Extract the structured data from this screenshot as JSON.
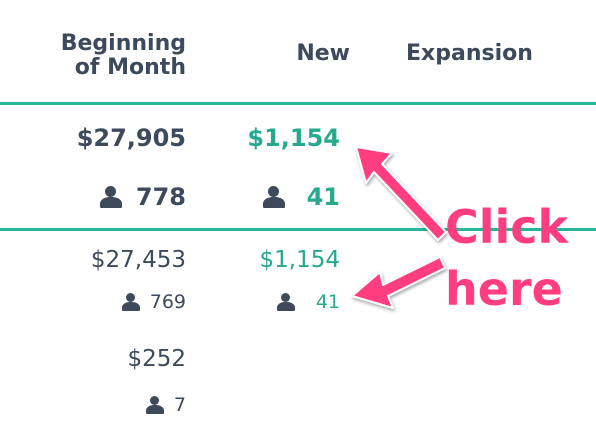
{
  "columns": {
    "beginning_line1": "Beginning",
    "beginning_line2": "of Month",
    "new": "New",
    "expansion": "Expansion"
  },
  "rows": [
    {
      "beginning_amount": "$27,905",
      "beginning_customers": "778",
      "new_amount": "$1,154",
      "new_customers": "41"
    },
    {
      "beginning_amount": "$27,453",
      "beginning_customers": "769",
      "new_amount": "$1,154",
      "new_customers": "41"
    },
    {
      "beginning_amount": "$252",
      "beginning_customers": "7"
    }
  ],
  "annotation": {
    "line1": "Click",
    "line2": "here"
  },
  "colors": {
    "accent": "#26b79a",
    "text": "#3c4a5c",
    "positive": "#26a98e",
    "annotation": "#ff3d7f"
  },
  "icons": {
    "customer": "person-icon"
  }
}
